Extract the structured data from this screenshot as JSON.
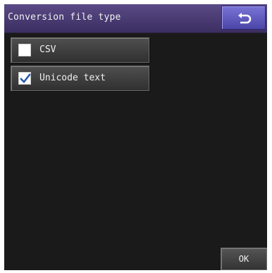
{
  "header": {
    "title": "Conversion file type",
    "back_icon": "return-arrow-icon"
  },
  "options": [
    {
      "label": "CSV",
      "checked": false
    },
    {
      "label": "Unicode text",
      "checked": true
    }
  ],
  "footer": {
    "ok_label": "OK"
  },
  "colors": {
    "titlebar": "#3b2e61",
    "back_button": "#5c55c0",
    "background": "#1b1a1a",
    "option_button": "#404040",
    "checkmark": "#2b5aa8"
  }
}
